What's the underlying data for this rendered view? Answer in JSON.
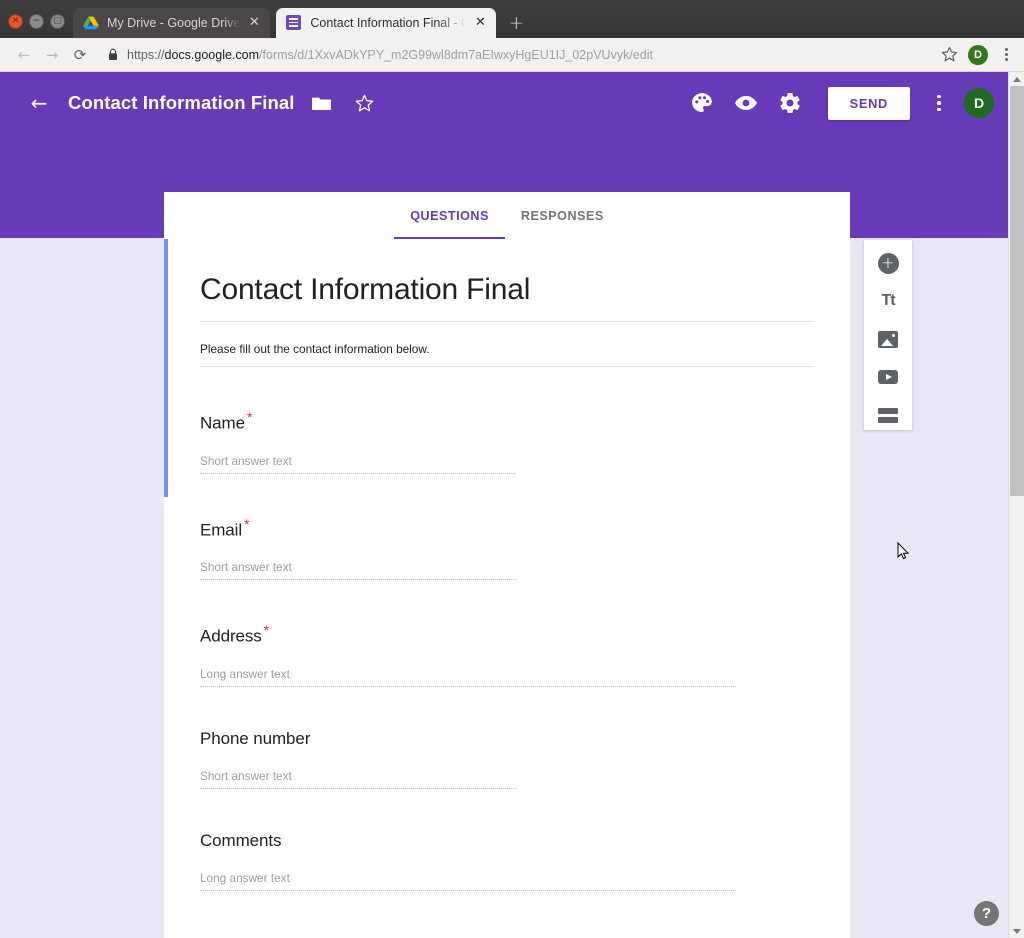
{
  "browser": {
    "window_controls": {
      "close": "✕",
      "minimize": "−",
      "maximize": "□"
    },
    "tabs": [
      {
        "title": "My Drive - Google Drive",
        "favicon": "google-drive-icon",
        "active": false,
        "close": "✕"
      },
      {
        "title": "Contact Information Final - Goog",
        "favicon": "google-forms-icon",
        "active": true,
        "close": "✕"
      }
    ],
    "new_tab_label": "+",
    "nav": {
      "back": "←",
      "forward": "→",
      "reload": "⟳"
    },
    "url": {
      "scheme": "https://",
      "host": "docs.google.com",
      "path": "/forms/d/1XxvADkYPY_m2G99wl8dm7aEIwxyHgEU1IJ_02pVUvyk/edit",
      "full": "https://docs.google.com/forms/d/1XxvADkYPY_m2G99wl8dm7aEIwxyHgEU1IJ_02pVUvyk/edit",
      "lock": "secure-lock-icon"
    },
    "omnibox_actions": {
      "bookmark": "star-icon",
      "profile_initial": "D",
      "menu": "chrome-menu-icon"
    }
  },
  "app_bar": {
    "back": "back-arrow-icon",
    "title": "Contact Information Final",
    "folder_icon": "folder-icon",
    "star_icon": "star-icon",
    "theme_icon": "palette-icon",
    "preview_icon": "eye-icon",
    "settings_icon": "gear-icon",
    "send_label": "SEND",
    "overflow_icon": "more-vert-icon",
    "account_initial": "D",
    "background_color": "#673ab7"
  },
  "form_tabs": [
    {
      "label": "QUESTIONS",
      "active": true
    },
    {
      "label": "RESPONSES",
      "active": false
    }
  ],
  "form": {
    "title": "Contact Information Final",
    "description": "Please fill out the contact information below.",
    "required_marker": "*",
    "questions": [
      {
        "label": "Name",
        "required": true,
        "answer_placeholder": "Short answer text",
        "type": "short"
      },
      {
        "label": "Email",
        "required": true,
        "answer_placeholder": "Short answer text",
        "type": "short"
      },
      {
        "label": "Address",
        "required": true,
        "answer_placeholder": "Long answer text",
        "type": "long"
      },
      {
        "label": "Phone number",
        "required": false,
        "answer_placeholder": "Short answer text",
        "type": "short"
      },
      {
        "label": "Comments",
        "required": false,
        "answer_placeholder": "Long answer text",
        "type": "long"
      }
    ]
  },
  "side_toolbar": {
    "items": [
      {
        "name": "add-question-button",
        "icon": "plus-circle-icon",
        "label": "+"
      },
      {
        "name": "add-title-description-button",
        "icon": "title-text-icon",
        "label": "Tt"
      },
      {
        "name": "add-image-button",
        "icon": "image-icon",
        "label": ""
      },
      {
        "name": "add-video-button",
        "icon": "video-icon",
        "label": ""
      },
      {
        "name": "add-section-button",
        "icon": "section-icon",
        "label": ""
      }
    ]
  },
  "help": {
    "label": "?"
  },
  "page": {
    "background_color": "#eae6f4",
    "accent_color": "#7c8df0"
  }
}
